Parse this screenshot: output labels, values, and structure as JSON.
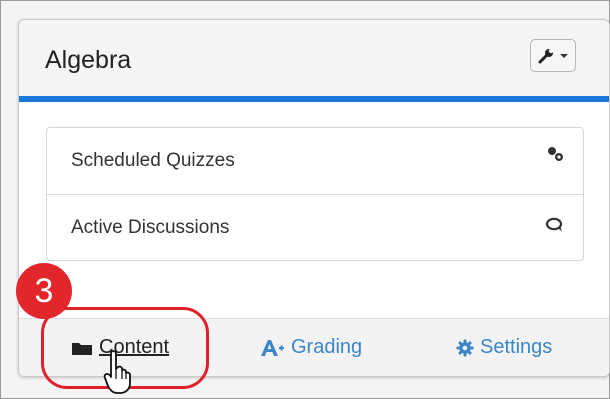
{
  "card": {
    "title": "Algebra",
    "accent_color": "#1c78d6"
  },
  "toolbar": {
    "icon": "wrench-icon",
    "dropdown_icon": "caret-down-icon"
  },
  "list": {
    "items": [
      {
        "label": "Scheduled Quizzes",
        "icon": "quiz-link-icon"
      },
      {
        "label": "Active Discussions",
        "icon": "discussion-icon"
      }
    ]
  },
  "footer": {
    "links": [
      {
        "label": "Content",
        "icon": "folder-icon"
      },
      {
        "label": "Grading",
        "icon": "grade-icon"
      },
      {
        "label": "Settings",
        "icon": "gear-icon"
      }
    ]
  },
  "annotation": {
    "step_number": "3",
    "highlight_color": "#e0202a"
  }
}
